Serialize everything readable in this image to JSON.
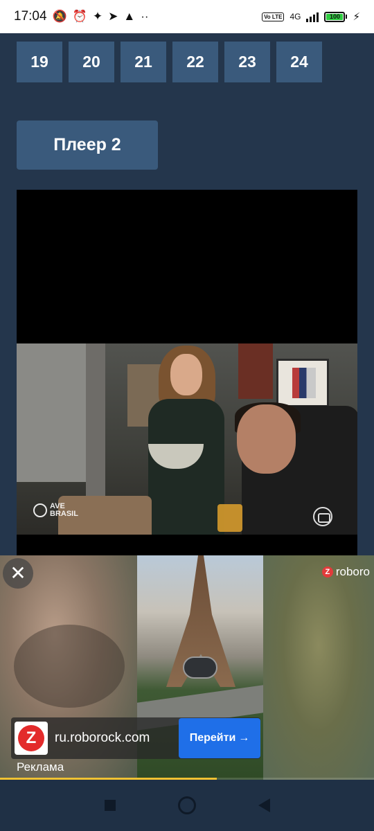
{
  "status_bar": {
    "time": "17:04",
    "icons_left": [
      "mute-notifications-icon",
      "alarm-icon",
      "sparkle-icon",
      "telegram-icon",
      "warning-icon",
      "more-dots-icon"
    ],
    "network": "4G",
    "volte": "Vo LTE",
    "battery": "100"
  },
  "episodes": {
    "partial_row": [
      "",
      "",
      "",
      "",
      "",
      ""
    ],
    "row": [
      "19",
      "20",
      "21",
      "22",
      "23",
      "24"
    ]
  },
  "player_button": {
    "label": "Плеер 2"
  },
  "video": {
    "logo_left": "AVE\nBRASIL"
  },
  "ad": {
    "brand": "roboro",
    "close_symbol": "✕",
    "domain": "ru.roborock.com",
    "go_label": "Перейти",
    "go_arrow": "→",
    "label": "Реклама",
    "progress": 0.58,
    "colors": {
      "cta": "#1f6fe8",
      "progress": "#f0c232",
      "brand_red": "#e32b2b"
    }
  },
  "nav_bar": {
    "buttons": [
      "recents-square-icon",
      "home-circle-icon",
      "back-triangle-icon"
    ]
  }
}
